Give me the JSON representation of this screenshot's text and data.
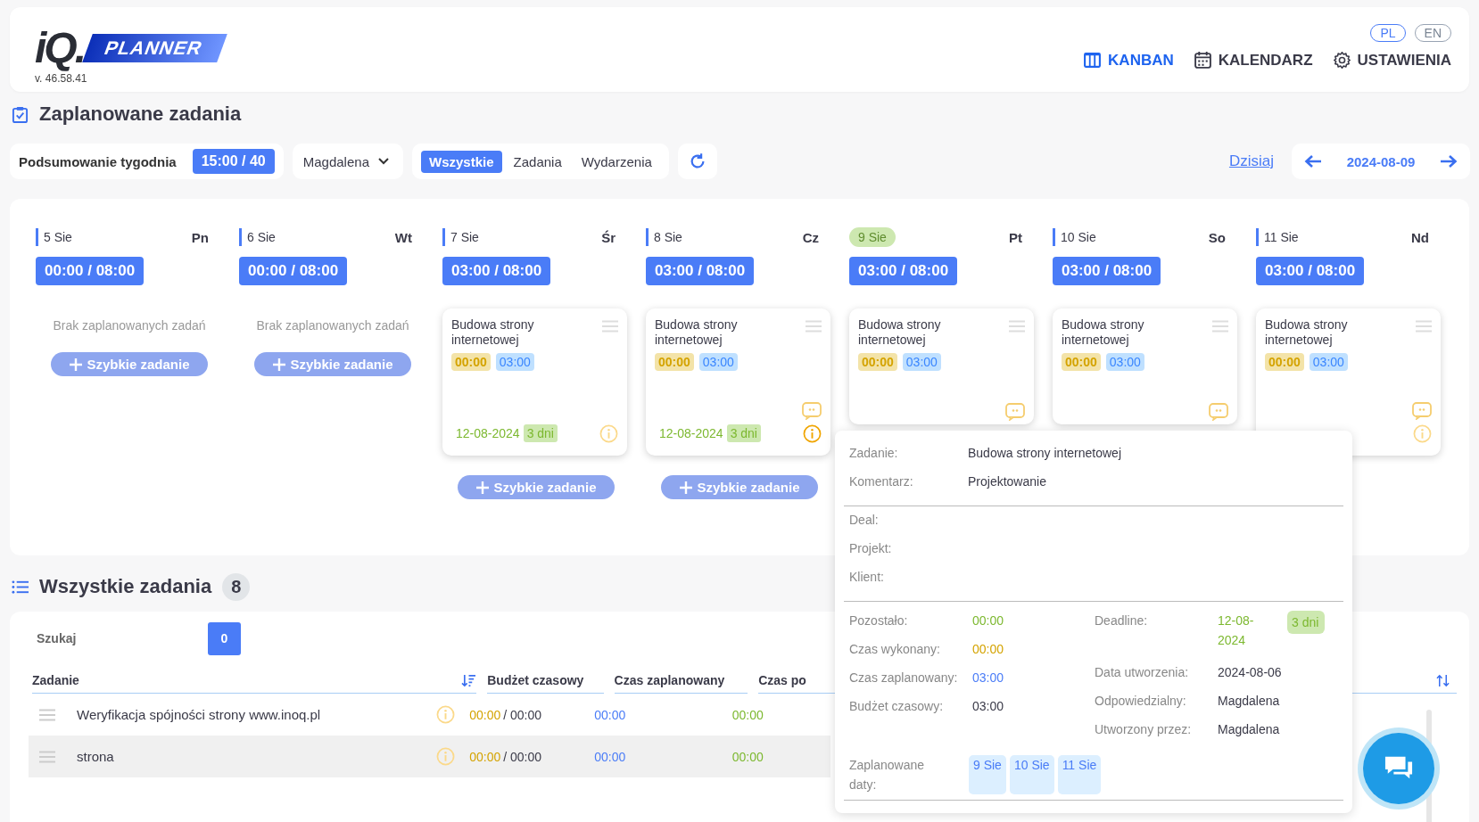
{
  "header": {
    "logo": {
      "mark": "iQ.",
      "name": "PLANNER"
    },
    "version": "v. 46.58.41",
    "languages": [
      {
        "label": "PL",
        "selected": true
      },
      {
        "label": "EN",
        "selected": false
      }
    ],
    "nav": [
      {
        "label": "KANBAN",
        "selected": true
      },
      {
        "label": "KALENDARZ",
        "selected": false
      },
      {
        "label": "USTAWIENIA",
        "selected": false
      }
    ]
  },
  "planned": {
    "title": "Zaplanowane zadania",
    "summary": {
      "label": "Podsumowanie tygodnia",
      "value": "15:00 / 40"
    },
    "person": "Magdalena",
    "filters": [
      {
        "label": "Wszystkie",
        "selected": true
      },
      {
        "label": "Zadania",
        "selected": false
      },
      {
        "label": "Wydarzenia",
        "selected": false
      }
    ],
    "today": "Dzisiaj",
    "date": "2024-08-09",
    "days": [
      {
        "date": "5 Sie",
        "weekday": "Pn",
        "today": false,
        "hours": "00:00 / 08:00",
        "empty": "Brak zaplanowanych zadań",
        "quick": "Szybkie zadanie"
      },
      {
        "date": "6 Sie",
        "weekday": "Wt",
        "today": false,
        "hours": "00:00 / 08:00",
        "empty": "Brak zaplanowanych zadań",
        "quick": "Szybkie zadanie"
      },
      {
        "date": "7 Sie",
        "weekday": "Śr",
        "today": false,
        "hours": "03:00 / 08:00",
        "quick": "Szybkie zadanie",
        "card": {
          "title": "Budowa strony internetowej",
          "done": "00:00",
          "planned": "03:00",
          "comment": false,
          "deadline": "12-08-2024",
          "days": "3 dni",
          "info": true,
          "info_highlighted": false
        }
      },
      {
        "date": "8 Sie",
        "weekday": "Cz",
        "today": false,
        "hours": "03:00 / 08:00",
        "quick": "Szybkie zadanie",
        "card": {
          "title": "Budowa strony internetowej",
          "done": "00:00",
          "planned": "03:00",
          "comment": true,
          "deadline": "12-08-2024",
          "days": "3 dni",
          "info": true,
          "info_highlighted": true
        }
      },
      {
        "date": "9 Sie",
        "weekday": "Pt",
        "today": true,
        "hours": "03:00 / 08:00",
        "card": {
          "title": "Budowa strony internetowej",
          "done": "00:00",
          "planned": "03:00",
          "comment": true,
          "info": false
        }
      },
      {
        "date": "10 Sie",
        "weekday": "So",
        "today": false,
        "hours": "03:00 / 08:00",
        "card": {
          "title": "Budowa strony internetowej",
          "done": "00:00",
          "planned": "03:00",
          "comment": true,
          "info": false
        }
      },
      {
        "date": "11 Sie",
        "weekday": "Nd",
        "today": false,
        "hours": "03:00 / 08:00",
        "card": {
          "title": "Budowa strony internetowej",
          "done": "00:00",
          "planned": "03:00",
          "comment": true,
          "info": true,
          "info_highlighted": false
        }
      }
    ]
  },
  "all_tasks": {
    "title": "Wszystkie zadania",
    "count": "8",
    "search_label": "Szukaj",
    "search_count": "0",
    "columns": [
      "Zadanie",
      "Budżet czasowy",
      "Czas zaplanowany",
      "Czas po"
    ],
    "rows": [
      {
        "name": "Weryfikacja spójności strony www.inoq.pl",
        "done": "00:00",
        "budget": "/ 00:00",
        "planned": "00:00",
        "remaining": "00:00",
        "selected": false
      },
      {
        "name": "strona",
        "done": "00:00",
        "budget": "/ 00:00",
        "planned": "00:00",
        "remaining": "00:00",
        "selected": true
      }
    ]
  },
  "tooltip": {
    "main": [
      {
        "label": "Zadanie:",
        "value": "Budowa strony internetowej"
      },
      {
        "label": "Komentarz:",
        "value": "Projektowanie"
      }
    ],
    "links": [
      {
        "label": "Deal:"
      },
      {
        "label": "Projekt:"
      },
      {
        "label": "Klient:"
      }
    ],
    "times": [
      {
        "label": "Pozostało:",
        "value": "00:00",
        "kind": "remaining"
      },
      {
        "label": "Czas wykonany:",
        "value": "00:00",
        "kind": "done"
      },
      {
        "label": "Czas zaplanowany:",
        "value": "03:00",
        "kind": "planned"
      },
      {
        "label": "Budżet czasowy:",
        "value": "03:00",
        "kind": "plain"
      }
    ],
    "deadline": {
      "label": "Deadline:",
      "value": "12-08-2024",
      "days": "3 dni"
    },
    "meta": [
      {
        "label": "Data utworzenia:",
        "value": "2024-08-06"
      },
      {
        "label": "Odpowiedzialny:",
        "value": "Magdalena"
      },
      {
        "label": "Utworzony przez:",
        "value": "Magdalena"
      }
    ],
    "dates_label": "Zaplanowane daty:",
    "dates": [
      "9 Sie",
      "10 Sie",
      "11 Sie"
    ]
  }
}
